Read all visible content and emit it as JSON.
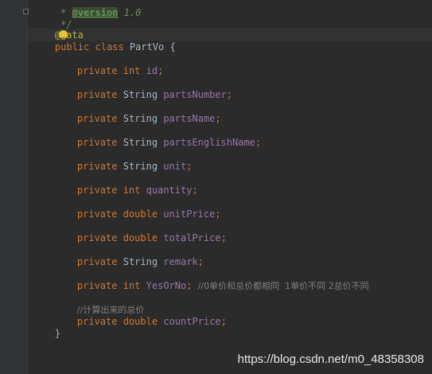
{
  "code": {
    "doc_prefix": " * ",
    "doc_tag": "@version",
    "doc_version": " 1.0",
    "doc_close": " */",
    "annotation_at": "@",
    "annotation_name": "ata",
    "class_kw_public": "public",
    "class_kw_class": "class",
    "class_name": "PartVo",
    "open_brace": "{",
    "close_brace": "}",
    "private_kw": "private",
    "fields": [
      {
        "type": "int",
        "type_is_keyword": true,
        "name": "id",
        "suffix": ";"
      },
      {
        "type": "String",
        "type_is_keyword": false,
        "name": "partsNumber",
        "suffix": ";"
      },
      {
        "type": "String",
        "type_is_keyword": false,
        "name": "partsName",
        "suffix": ";"
      },
      {
        "type": "String",
        "type_is_keyword": false,
        "name": "partsEnglishName",
        "suffix": ";"
      },
      {
        "type": "String",
        "type_is_keyword": false,
        "name": "unit",
        "suffix": ";"
      },
      {
        "type": "int",
        "type_is_keyword": true,
        "name": "quantity",
        "suffix": ";"
      },
      {
        "type": "double",
        "type_is_keyword": true,
        "name": "unitPrice",
        "suffix": ";"
      },
      {
        "type": "double",
        "type_is_keyword": true,
        "name": "totalPrice",
        "suffix": ";"
      },
      {
        "type": "String",
        "type_is_keyword": false,
        "name": "remark",
        "suffix": ";"
      },
      {
        "type": "int",
        "type_is_keyword": true,
        "name": "YesOrNo",
        "suffix": ";"
      }
    ],
    "yesorno_comment": "//0单价和总价都相同  1单价不同 2总价不同",
    "count_comment": "//计算出来的总价",
    "count_field": {
      "type": "double",
      "name": "countPrice",
      "suffix": ";"
    }
  },
  "watermark": "https://blog.csdn.net/m0_48358308",
  "colors": {
    "background": "#2b2b2b",
    "keyword": "#cc7832",
    "field": "#9876aa",
    "plain": "#a9b7c6",
    "comment": "#808080",
    "doc_comment": "#629755",
    "annotation": "#bbb529"
  },
  "icons": {
    "intention_bulb": "lightbulb-icon",
    "fold": "fold-marker-icon"
  }
}
